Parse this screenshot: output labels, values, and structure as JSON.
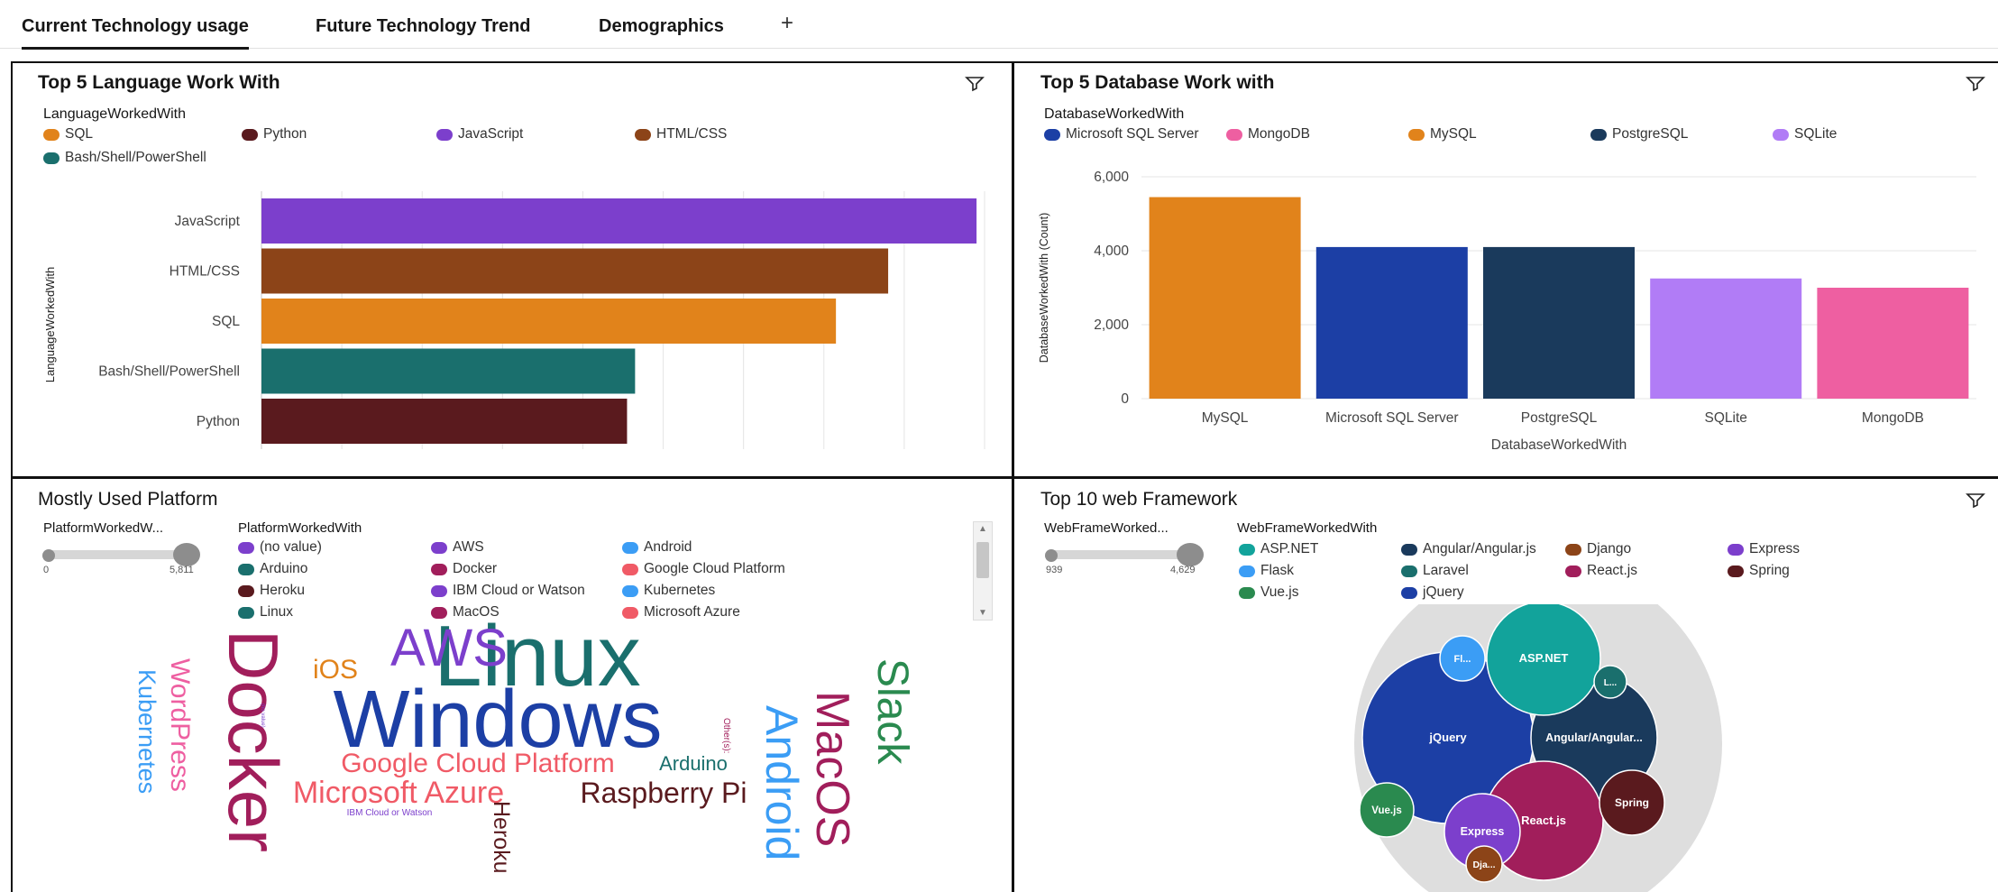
{
  "tabs": [
    {
      "label": "Current Technology usage",
      "active": true
    },
    {
      "label": "Future Technology Trend",
      "active": false
    },
    {
      "label": "Demographics",
      "active": false
    }
  ],
  "add_tab_label": "+",
  "panels": {
    "lang": {
      "title": "Top 5 Language Work With",
      "legend_title": "LanguageWorkedWith",
      "legend": [
        {
          "name": "SQL",
          "color": "#e1831b"
        },
        {
          "name": "Python",
          "color": "#5a1a1e"
        },
        {
          "name": "JavaScript",
          "color": "#7c3fcc"
        },
        {
          "name": "HTML/CSS",
          "color": "#8c4418"
        },
        {
          "name": "Bash/Shell/PowerShell",
          "color": "#1a6f6d"
        }
      ]
    },
    "db": {
      "title": "Top 5 Database Work with",
      "legend_title": "DatabaseWorkedWith",
      "legend": [
        {
          "name": "Microsoft SQL Server",
          "color": "#1c3fa5"
        },
        {
          "name": "MongoDB",
          "color": "#ee5fa1"
        },
        {
          "name": "MySQL",
          "color": "#e1831b"
        },
        {
          "name": "PostgreSQL",
          "color": "#1a3a5c"
        },
        {
          "name": "SQLite",
          "color": "#b17cf6"
        }
      ]
    },
    "platform": {
      "title": "Mostly Used Platform",
      "slider_title": "PlatformWorkedW...",
      "slider_min": "0",
      "slider_max": "5,811",
      "legend_title": "PlatformWorkedWith",
      "legend": [
        {
          "name": "(no value)",
          "color": "#7c3fcc"
        },
        {
          "name": "AWS",
          "color": "#7c3fcc"
        },
        {
          "name": "Android",
          "color": "#3b9df5"
        },
        {
          "name": "Arduino",
          "color": "#1a6f6d"
        },
        {
          "name": "Docker",
          "color": "#a11e5b"
        },
        {
          "name": "Google Cloud Platform",
          "color": "#f05a66"
        },
        {
          "name": "Heroku",
          "color": "#5a1a1e"
        },
        {
          "name": "IBM Cloud or Watson",
          "color": "#7c3fcc"
        },
        {
          "name": "Kubernetes",
          "color": "#3b9df5"
        },
        {
          "name": "Linux",
          "color": "#1a6f6d"
        },
        {
          "name": "MacOS",
          "color": "#a11e5b"
        },
        {
          "name": "Microsoft Azure",
          "color": "#f05a66"
        }
      ],
      "words": [
        {
          "text": "Linux",
          "color": "#1a6f6d"
        },
        {
          "text": "Windows",
          "color": "#1c3fa5"
        },
        {
          "text": "Docker",
          "color": "#a11e5b"
        },
        {
          "text": "AWS",
          "color": "#7c3fcc"
        },
        {
          "text": "iOS",
          "color": "#e1831b"
        },
        {
          "text": "Slack",
          "color": "#2a8a4f"
        },
        {
          "text": "MacOS",
          "color": "#a11e5b"
        },
        {
          "text": "Android",
          "color": "#3b9df5"
        },
        {
          "text": "Google Cloud Platform",
          "color": "#f05a66"
        },
        {
          "text": "Microsoft Azure",
          "color": "#f05a66"
        },
        {
          "text": "Raspberry Pi",
          "color": "#5a1a1e"
        },
        {
          "text": "Arduino",
          "color": "#1a6f6d"
        },
        {
          "text": "WordPress",
          "color": "#ee5fa1"
        },
        {
          "text": "Kubernetes",
          "color": "#3b9df5"
        },
        {
          "text": "Heroku",
          "color": "#5a1a1e"
        },
        {
          "text": "IBM Cloud or Watson",
          "color": "#7c3fcc"
        },
        {
          "text": "Other(s):",
          "color": "#a11e5b"
        },
        {
          "text": "(no value)",
          "color": "#7c3fcc"
        }
      ]
    },
    "web": {
      "title": "Top 10 web Framework",
      "slider_title": "WebFrameWorked...",
      "slider_min": "939",
      "slider_max": "4,629",
      "legend_title": "WebFrameWorkedWith",
      "legend": [
        {
          "name": "ASP.NET",
          "color": "#12a39b"
        },
        {
          "name": "Angular/Angular.js",
          "color": "#1a3a5c"
        },
        {
          "name": "Django",
          "color": "#8c4418"
        },
        {
          "name": "Express",
          "color": "#7c3fcc"
        },
        {
          "name": "Flask",
          "color": "#3b9df5"
        },
        {
          "name": "Laravel",
          "color": "#1a6f6d"
        },
        {
          "name": "React.js",
          "color": "#a11e5b"
        },
        {
          "name": "Spring",
          "color": "#5a1a1e"
        },
        {
          "name": "Vue.js",
          "color": "#2a8a4f"
        },
        {
          "name": "jQuery",
          "color": "#1c3fa5"
        }
      ],
      "bubbles": [
        {
          "label": "jQuery",
          "color": "#1c3fa5"
        },
        {
          "label": "Angular/Angular...",
          "color": "#1a3a5c"
        },
        {
          "label": "React.js",
          "color": "#a11e5b"
        },
        {
          "label": "ASP.NET",
          "color": "#12a39b"
        },
        {
          "label": "Express",
          "color": "#7c3fcc"
        },
        {
          "label": "Spring",
          "color": "#5a1a1e"
        },
        {
          "label": "Vue.js",
          "color": "#2a8a4f"
        },
        {
          "label": "Fl...",
          "color": "#3b9df5"
        },
        {
          "label": "L...",
          "color": "#1a6f6d"
        },
        {
          "label": "Dja...",
          "color": "#8c4418"
        }
      ]
    }
  },
  "chart_data": [
    {
      "type": "bar",
      "orientation": "horizontal",
      "title": "Top 5 Language Work With",
      "ylabel": "LanguageWorkedWith",
      "categories": [
        "JavaScript",
        "HTML/CSS",
        "SQL",
        "Bash/Shell/PowerShell",
        "Python"
      ],
      "values": [
        8900,
        7800,
        7150,
        4650,
        4550
      ],
      "colors": [
        "#7c3fcc",
        "#8c4418",
        "#e1831b",
        "#1a6f6d",
        "#5a1a1e"
      ],
      "xlim": [
        0,
        9000
      ],
      "grid": true
    },
    {
      "type": "bar",
      "title": "Top 5 Database Work with",
      "xlabel": "DatabaseWorkedWith",
      "ylabel": "DatabaseWorkedWith (Count)",
      "categories": [
        "MySQL",
        "Microsoft SQL Server",
        "PostgreSQL",
        "SQLite",
        "MongoDB"
      ],
      "values": [
        5450,
        4100,
        4100,
        3250,
        3000
      ],
      "colors": [
        "#e1831b",
        "#1c3fa5",
        "#1a3a5c",
        "#b17cf6",
        "#ee5fa1"
      ],
      "ylim": [
        0,
        6000
      ],
      "yticks": [
        "0",
        "2,000",
        "4,000",
        "6,000"
      ],
      "grid": true
    }
  ]
}
